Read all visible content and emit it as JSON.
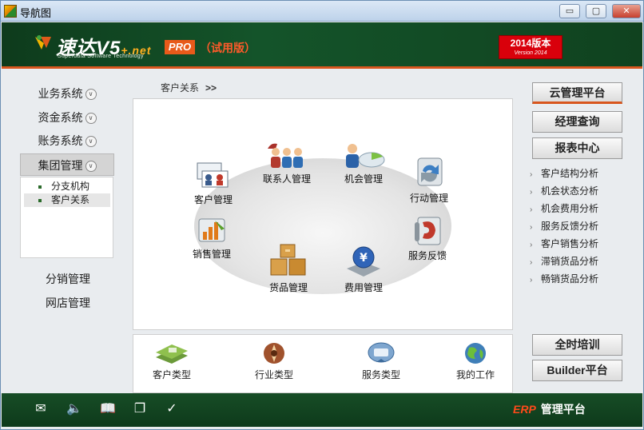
{
  "window": {
    "title": "导航图",
    "min": "▭",
    "max": "▢",
    "close": "✕"
  },
  "header": {
    "logo": "速达V5",
    "logo_suffix": "+.net",
    "logo_sub": "Superdata Software Technology",
    "pro": "PRO",
    "trial": "（试用版）",
    "version_main": "2014版本",
    "version_sub": "Version 2014"
  },
  "leftnav": {
    "items": [
      {
        "label": "业务系统"
      },
      {
        "label": "资金系统"
      },
      {
        "label": "账务系统"
      },
      {
        "label": "集团管理"
      }
    ],
    "subitems": [
      {
        "label": "分支机构"
      },
      {
        "label": "客户关系"
      }
    ],
    "links": [
      {
        "label": "分销管理"
      },
      {
        "label": "网店管理"
      }
    ]
  },
  "breadcrumb": {
    "label": "客户关系",
    "arrow": ">>"
  },
  "main": {
    "functions": [
      {
        "label": "客户管理"
      },
      {
        "label": "联系人管理"
      },
      {
        "label": "机会管理"
      },
      {
        "label": "行动管理"
      },
      {
        "label": "销售管理"
      },
      {
        "label": "货品管理"
      },
      {
        "label": "费用管理"
      },
      {
        "label": "服务反馈"
      }
    ]
  },
  "bottom": {
    "functions": [
      {
        "label": "客户类型"
      },
      {
        "label": "行业类型"
      },
      {
        "label": "服务类型"
      },
      {
        "label": "我的工作"
      }
    ]
  },
  "right": {
    "buttons": [
      {
        "label": "云管理平台"
      },
      {
        "label": "经理查询"
      },
      {
        "label": "报表中心"
      }
    ],
    "reports": [
      {
        "label": "客户结构分析"
      },
      {
        "label": "机会状态分析"
      },
      {
        "label": "机会费用分析"
      },
      {
        "label": "服务反馈分析"
      },
      {
        "label": "客户销售分析"
      },
      {
        "label": "滞销货品分析"
      },
      {
        "label": "畅销货品分析"
      }
    ],
    "bottom_buttons": [
      {
        "label": "全时培训"
      },
      {
        "label": "Builder平台"
      }
    ]
  },
  "statusbar": {
    "erp": "ERP",
    "platform": "管理平台"
  },
  "colors": {
    "accent": "#d8561e",
    "brand_green": "#14542a",
    "trial_red": "#ff5a2a"
  }
}
